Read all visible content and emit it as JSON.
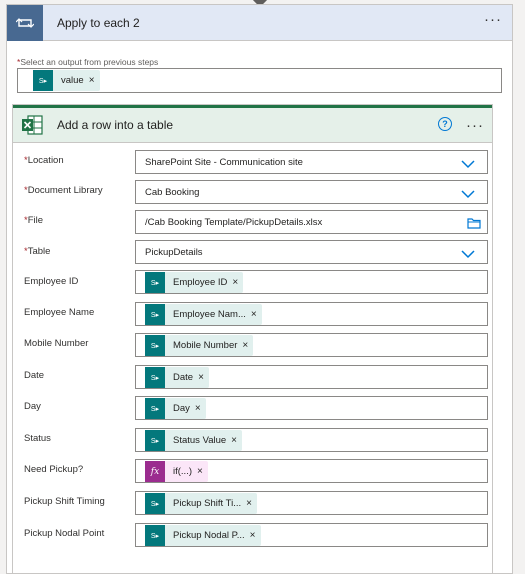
{
  "loop": {
    "title": "Apply to each 2",
    "more": "···"
  },
  "select_output": {
    "label": "Select an output from previous steps",
    "required": "*",
    "token": "value"
  },
  "excel": {
    "title": "Add a row into a table",
    "help": "?",
    "more": "···"
  },
  "fields": [
    {
      "label": "Location",
      "required": "*",
      "value": "SharePoint Site - Communication site"
    },
    {
      "label": "Document Library",
      "required": "*",
      "value": "Cab Booking"
    },
    {
      "label": "File",
      "required": "*",
      "value": "/Cab Booking Template/PickupDetails.xlsx"
    },
    {
      "label": "Table",
      "required": "*",
      "value": "PickupDetails"
    },
    {
      "label": "Employee ID",
      "token": "Employee ID"
    },
    {
      "label": "Employee Name",
      "token": "Employee Nam..."
    },
    {
      "label": "Mobile Number",
      "token": "Mobile Number"
    },
    {
      "label": "Date",
      "token": "Date"
    },
    {
      "label": "Day",
      "token": "Day"
    },
    {
      "label": "Status",
      "token": "Status Value"
    },
    {
      "label": "Need Pickup?",
      "token": "if(...)",
      "token_fx": "fx"
    },
    {
      "label": "Pickup Shift Timing",
      "token": "Pickup Shift Ti..."
    },
    {
      "label": "Pickup Nodal Point",
      "token": "Pickup Nodal P..."
    }
  ],
  "token_close": "×",
  "colors": {
    "loop_icon": "#486991",
    "excel_green": "#217346",
    "sharepoint_teal": "#03787c",
    "expression_purple": "#9b2c8f",
    "accent_blue": "#0078d4"
  }
}
